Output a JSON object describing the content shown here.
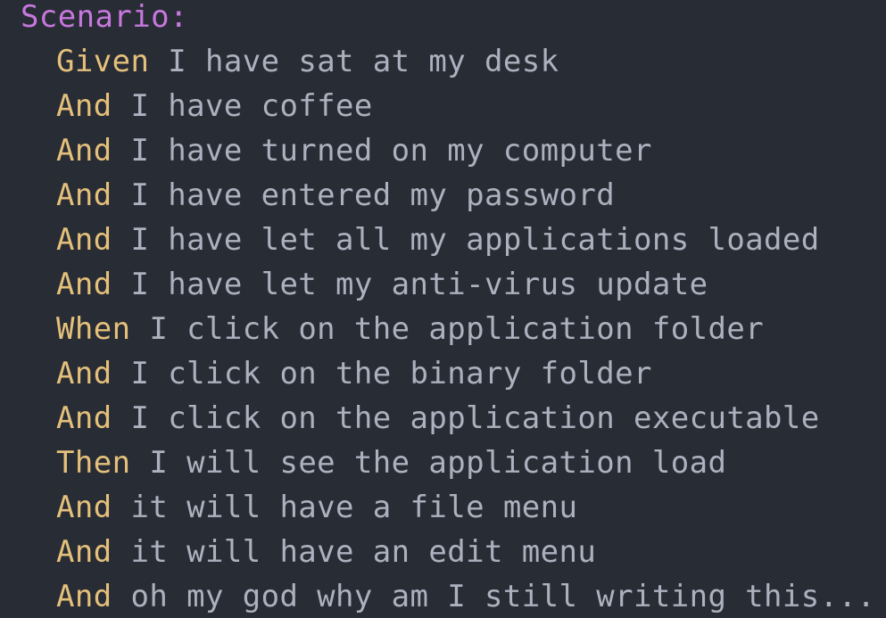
{
  "colors": {
    "background": "#282c34",
    "heading": "#c678dd",
    "keyword": "#e5c07b",
    "text": "#abb2bf"
  },
  "scenario": {
    "heading": "Scenario:",
    "steps": [
      {
        "keyword": "Given",
        "text": "I have sat at my desk"
      },
      {
        "keyword": "And",
        "text": "I have coffee"
      },
      {
        "keyword": "And",
        "text": "I have turned on my computer"
      },
      {
        "keyword": "And",
        "text": "I have entered my password"
      },
      {
        "keyword": "And",
        "text": "I have let all my applications loaded"
      },
      {
        "keyword": "And",
        "text": "I have let my anti-virus update"
      },
      {
        "keyword": "When",
        "text": "I click on the application folder"
      },
      {
        "keyword": "And",
        "text": "I click on the binary folder"
      },
      {
        "keyword": "And",
        "text": "I click on the application executable"
      },
      {
        "keyword": "Then",
        "text": "I will see the application load"
      },
      {
        "keyword": "And",
        "text": "it will have a file menu"
      },
      {
        "keyword": "And",
        "text": "it will have an edit menu"
      },
      {
        "keyword": "And",
        "text": "oh my god why am I still writing this..."
      }
    ]
  }
}
